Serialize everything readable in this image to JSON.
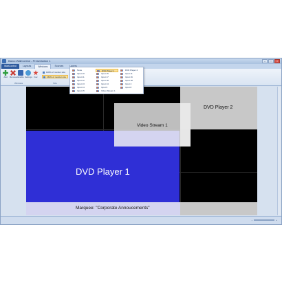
{
  "window": {
    "title": "Barco WallControl - Presentation 1",
    "minimize": "–",
    "maximize": "□",
    "close": "×"
  },
  "tabs": [
    "WallControl",
    "Layouts",
    "Windows",
    "Sources",
    "Layers"
  ],
  "ribbon": {
    "tools": [
      {
        "label": "Add",
        "icon": "add-icon",
        "color": "#2e9e3e"
      },
      {
        "label": "Remove",
        "icon": "remove-icon",
        "color": "#c83a32"
      },
      {
        "label": "Enable",
        "icon": "enable-icon",
        "color": "#3466b0"
      },
      {
        "label": "Settings",
        "icon": "settings-icon",
        "color": "#4c9ad6"
      },
      {
        "label": "Fav",
        "icon": "star-icon",
        "color": "#d8453a"
      }
    ],
    "options": [
      {
        "label": "100% of monitor size",
        "selected": false
      },
      {
        "label": "150% of monitor size",
        "selected": true
      }
    ],
    "group_windows": "Windows",
    "group_size": "Size"
  },
  "flyout": {
    "columns": [
      [
        "None",
        "Input 10",
        "Input 11",
        "Input 12",
        "Input 13",
        "Input 14",
        "Input 15"
      ],
      [
        "DVD Player 1",
        "Input 15",
        "Input 17",
        "Input 18",
        "Input 14",
        "Input 9",
        "Video Stream 1"
      ],
      [
        "DVD Player 2",
        "Input 11",
        "Input 16",
        "Input 18",
        "Input 4",
        "Input 8"
      ]
    ],
    "selected": "DVD Player 1"
  },
  "canvas": {
    "sources": {
      "dvd2": "DVD Player 2",
      "video": "Video Stream 1",
      "dvd1": "DVD Player 1",
      "marquee": "Marquee:  \"Corporate Annoucements\""
    },
    "colors": {
      "dvd1": "#2f2fd6",
      "marquee": "#d4d4f0",
      "background": "#000000",
      "gray": "#c8c8c8"
    }
  },
  "statusbar": {
    "zoom_minus": "–",
    "zoom_plus": "+"
  }
}
